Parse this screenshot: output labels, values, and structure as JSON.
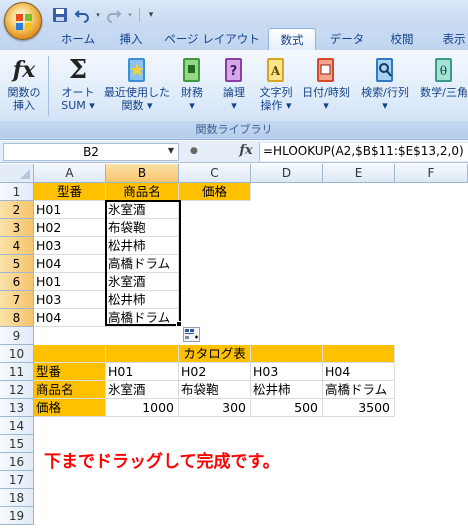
{
  "colors": {
    "accent": "#ffc000",
    "note": "#ff0000",
    "ribbon": "#deebfa"
  },
  "tabs": [
    "ホーム",
    "挿入",
    "ページ レイアウト",
    "数式",
    "データ",
    "校閲",
    "表示"
  ],
  "active_tab": "数式",
  "ribbon": {
    "buttons": [
      {
        "label1": "関数の",
        "label2": "挿入",
        "icon": "fx-icon"
      },
      {
        "label1": "オート",
        "label2": "SUM ▾",
        "icon": "sigma-icon"
      },
      {
        "label1": "最近使用した",
        "label2": "関数 ▾",
        "icon": "recent-book-icon"
      },
      {
        "label1": "財務",
        "label2": "▾",
        "icon": "finance-book-icon"
      },
      {
        "label1": "論理",
        "label2": "▾",
        "icon": "logic-book-icon"
      },
      {
        "label1": "文字列",
        "label2": "操作 ▾",
        "icon": "text-book-icon"
      },
      {
        "label1": "日付/時刻",
        "label2": "▾",
        "icon": "date-book-icon"
      },
      {
        "label1": "検索/行列",
        "label2": "▾",
        "icon": "lookup-book-icon"
      },
      {
        "label1": "数学/三角",
        "label2": "",
        "icon": "math-book-icon"
      }
    ],
    "group_label": "関数ライブラリ"
  },
  "formula_bar": {
    "name_box": "B2",
    "formula": "=HLOOKUP(A2,$B$11:$E$13,2,0)"
  },
  "columns": [
    "A",
    "B",
    "C",
    "D",
    "E",
    "F"
  ],
  "rows": [
    "1",
    "2",
    "3",
    "4",
    "5",
    "6",
    "7",
    "8",
    "9",
    "10",
    "11",
    "12",
    "13",
    "14",
    "15",
    "16",
    "17",
    "18",
    "19"
  ],
  "cells": {
    "header_row": [
      "型番",
      "商品名",
      "価格"
    ],
    "data_a": [
      "H01",
      "H02",
      "H03",
      "H04",
      "H01",
      "H03",
      "H04"
    ],
    "data_b": [
      "氷室酒",
      "布袋鞄",
      "松井柿",
      "高橋ドラム",
      "氷室酒",
      "松井柿",
      "高橋ドラム"
    ],
    "catalog_title": "カタログ表",
    "catalog_labels": [
      "型番",
      "商品名",
      "価格"
    ],
    "catalog_codes": [
      "H01",
      "H02",
      "H03",
      "H04"
    ],
    "catalog_names": [
      "氷室酒",
      "布袋鞄",
      "松井柿",
      "高橋ドラム"
    ],
    "catalog_prices": [
      "1000",
      "300",
      "500",
      "3500"
    ]
  },
  "note": "下までドラッグして完成です。"
}
